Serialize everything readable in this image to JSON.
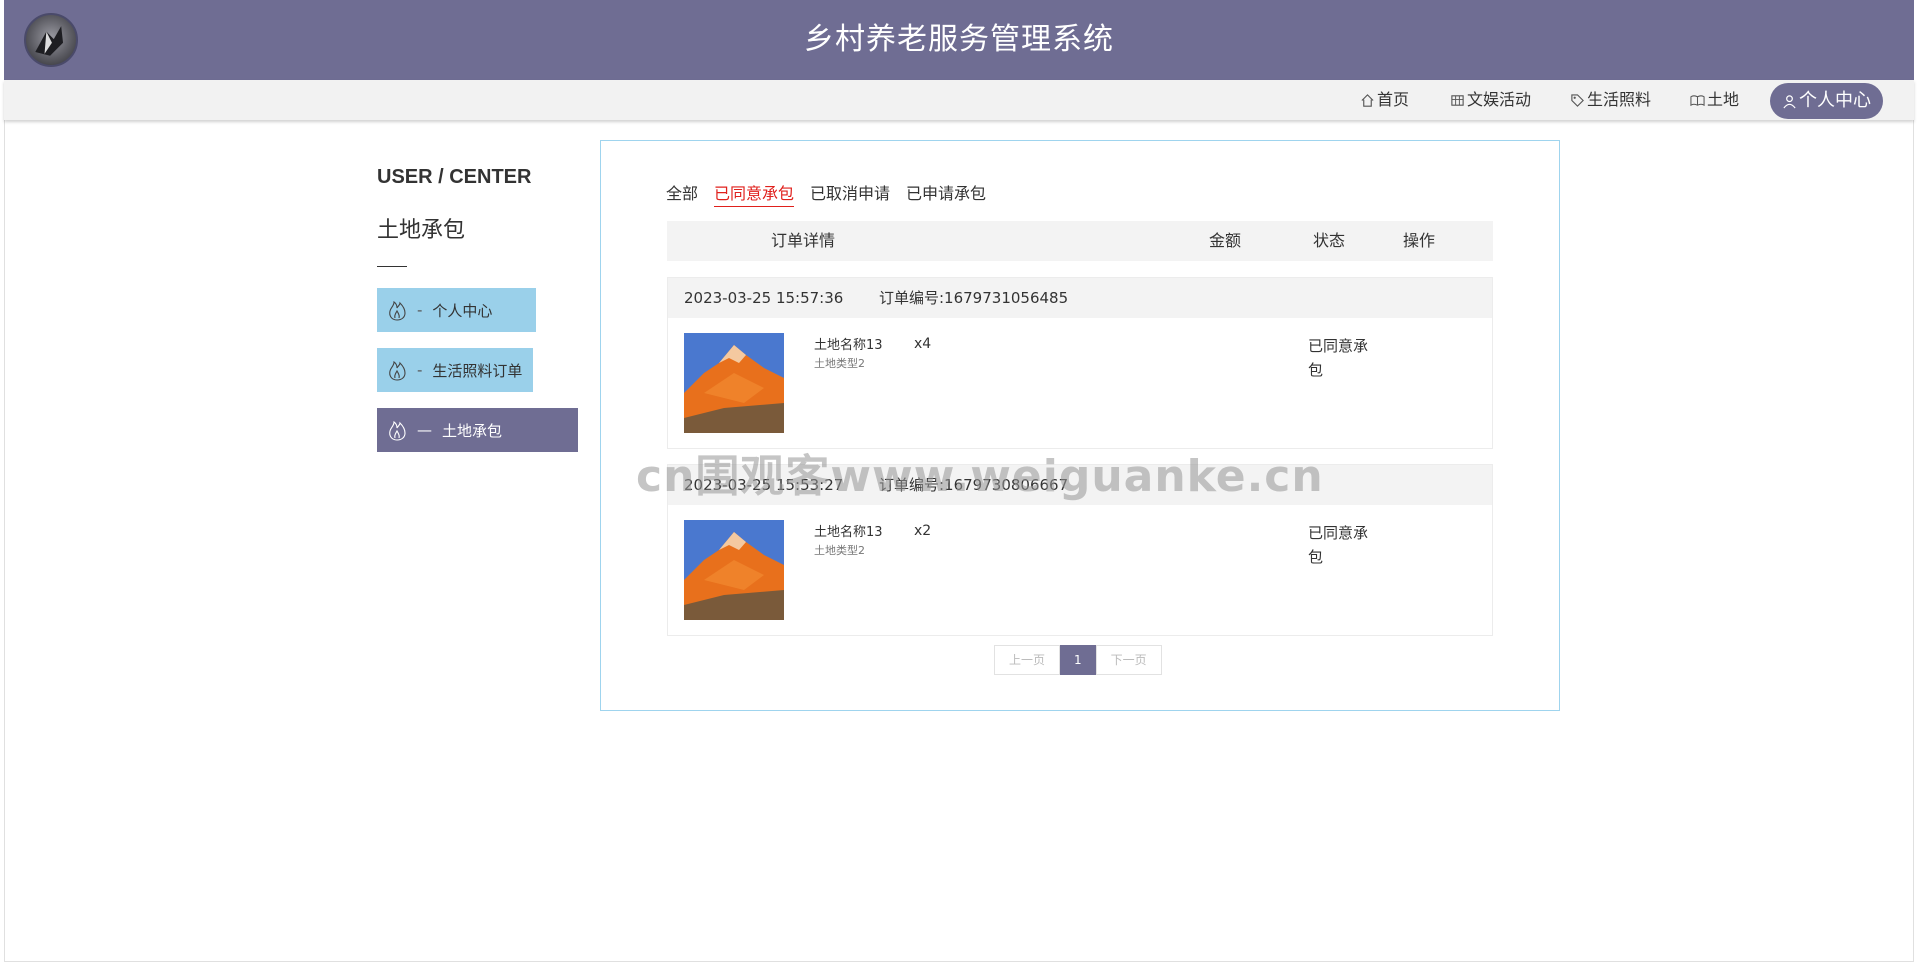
{
  "header": {
    "title": "乡村养老服务管理系统",
    "logo_icon": "logo-icon",
    "background": "#6f6d93"
  },
  "nav": {
    "items": [
      {
        "label": "首页",
        "icon": "home-icon"
      },
      {
        "label": "文娱活动",
        "icon": "grid-icon"
      },
      {
        "label": "生活照料",
        "icon": "tag-icon"
      },
      {
        "label": "土地",
        "icon": "book-icon"
      },
      {
        "label": "个人中心",
        "icon": "user-icon",
        "active": true
      }
    ]
  },
  "sidebar": {
    "title_en": "USER / CENTER",
    "title_cn": "土地承包",
    "items": [
      {
        "label": "个人中心",
        "icon": "flame-icon",
        "dash": "-"
      },
      {
        "label": "生活照料订单",
        "icon": "flame-icon",
        "dash": "-"
      },
      {
        "label": "土地承包",
        "icon": "flame-icon",
        "dash": "—",
        "active": true
      }
    ],
    "item_color": "#9ad0ea",
    "active_color": "#6f6d93"
  },
  "tabs": [
    {
      "label": "全部"
    },
    {
      "label": "已同意承包",
      "active": true
    },
    {
      "label": "已取消申请"
    },
    {
      "label": "已申请承包"
    }
  ],
  "table": {
    "headers": [
      "订单详情",
      "金额",
      "状态",
      "操作"
    ]
  },
  "orders": [
    {
      "time": "2023-03-25 15:57:36",
      "order_no": "订单编号:1679731056485",
      "name": "土地名称13",
      "type": "土地类型2",
      "qty": "x4",
      "status": "已同意承包"
    },
    {
      "time": "2023-03-25 15:53:27",
      "order_no": "订单编号:1679730806667",
      "name": "土地名称13",
      "type": "土地类型2",
      "qty": "x2",
      "status": "已同意承包"
    }
  ],
  "pager": {
    "prev": "上一页",
    "current": "1",
    "next": "下一页"
  },
  "watermark": "cn围观客www.weiguanke.cn"
}
